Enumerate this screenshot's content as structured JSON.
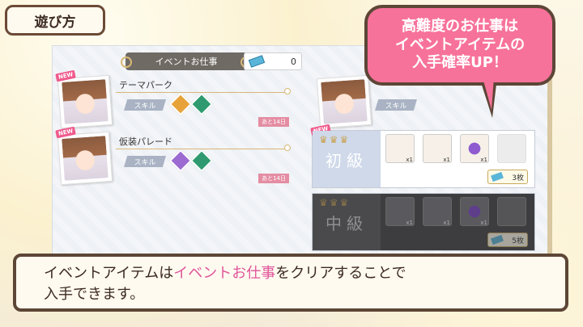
{
  "title_tab": {
    "label": "遊び方"
  },
  "event_header": {
    "label": "イベントお仕事",
    "ticket_count": "0"
  },
  "jobs": [
    {
      "new": "NEW",
      "name": "テーマパーク",
      "skill_label": "スキル",
      "remain": "あと14日"
    },
    {
      "new": "NEW",
      "name": "仮装パレード",
      "skill_label": "スキル",
      "remain": "あと14日"
    }
  ],
  "right_card": {
    "new": "NEW",
    "skill_label": "スキル"
  },
  "tiers": [
    {
      "rank": "初級",
      "items": [
        "x1",
        "x1",
        "x1"
      ],
      "cost": "3枚"
    },
    {
      "rank": "中級",
      "items": [
        "x1",
        "x1",
        "x1"
      ],
      "cost": "5枚"
    }
  ],
  "bubble": {
    "line1": "高難度のお仕事は",
    "line2": "イベントアイテムの",
    "line3": "入手確率UP！"
  },
  "info": {
    "pre": "イベントアイテムは",
    "highlight": "イベントお仕事",
    "post": "をクリアすることで",
    "line2": "入手できます。"
  },
  "colors": {
    "bubble": "#f7729a",
    "highlight": "#e0559a",
    "frame": "#5d4636"
  }
}
